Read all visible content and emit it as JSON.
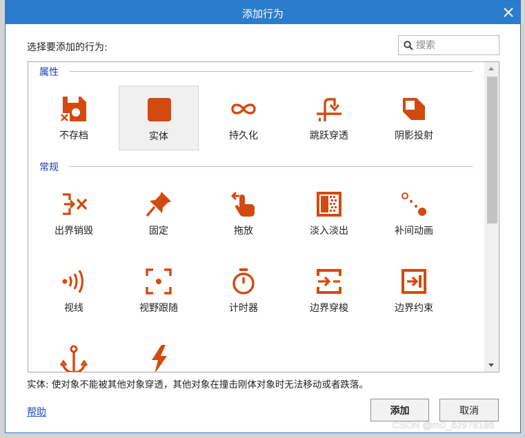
{
  "dialog": {
    "title": "添加行为",
    "prompt": "选择要添加的行为:",
    "search_placeholder": "搜索",
    "description": "实体: 使对象不能被其他对象穿透，其他对象在撞击刚体对象时无法移动或者跌落。",
    "help_label": "帮助",
    "add_label": "添加",
    "cancel_label": "取消"
  },
  "colors": {
    "accent": "#2b7ccc",
    "icon": "#d34a10",
    "category": "#1f3ea8"
  },
  "categories": [
    {
      "name": "属性",
      "items": [
        {
          "label": "不存档",
          "icon": "floppy-x-icon"
        },
        {
          "label": "实体",
          "icon": "solid-square-icon",
          "selected": true
        },
        {
          "label": "持久化",
          "icon": "infinity-icon"
        },
        {
          "label": "跳跃穿透",
          "icon": "jump-through-icon"
        },
        {
          "label": "阴影投射",
          "icon": "shadow-cast-icon"
        }
      ]
    },
    {
      "name": "常规",
      "items": [
        {
          "label": "出界销毁",
          "icon": "destroy-outside-icon"
        },
        {
          "label": "固定",
          "icon": "pin-icon"
        },
        {
          "label": "拖放",
          "icon": "drag-drop-icon"
        },
        {
          "label": "淡入淡出",
          "icon": "fade-icon"
        },
        {
          "label": "补间动画",
          "icon": "tween-icon"
        },
        {
          "label": "视线",
          "icon": "line-of-sight-icon"
        },
        {
          "label": "视野跟随",
          "icon": "scroll-to-icon"
        },
        {
          "label": "计时器",
          "icon": "timer-icon"
        },
        {
          "label": "边界穿梭",
          "icon": "wrap-icon"
        },
        {
          "label": "边界约束",
          "icon": "bound-to-layout-icon"
        },
        {
          "label": "",
          "icon": "anchor-icon"
        },
        {
          "label": "",
          "icon": "lightning-icon"
        }
      ]
    }
  ],
  "watermark": "CSDN @m0_62978196"
}
